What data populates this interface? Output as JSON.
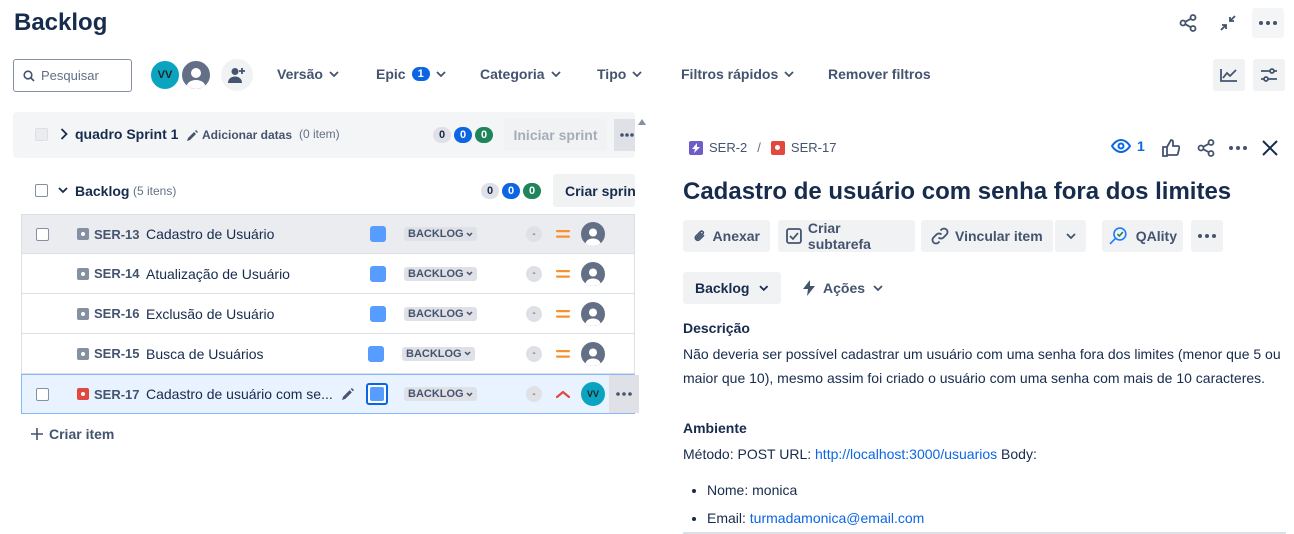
{
  "page": {
    "title": "Backlog"
  },
  "header": {
    "icons": [
      "share-icon",
      "collapse-icon",
      "more-icon"
    ]
  },
  "filters": {
    "search_placeholder": "Pesquisar",
    "avatar_initials": "VV",
    "items": [
      {
        "label": "Versão"
      },
      {
        "label": "Epic",
        "badge": "1"
      },
      {
        "label": "Categoria"
      },
      {
        "label": "Tipo"
      },
      {
        "label": "Filtros rápidos"
      }
    ],
    "clear_label": "Remover filtros"
  },
  "sprint": {
    "name": "quadro Sprint 1",
    "add_dates": "Adicionar datas",
    "count": "(0 item)",
    "counts": [
      "0",
      "0",
      "0"
    ],
    "start_label": "Iniciar sprint"
  },
  "backlog": {
    "name": "Backlog",
    "count": "(5 itens)",
    "counts": [
      "0",
      "0",
      "0"
    ],
    "create_sprint_label": "Criar sprint",
    "rows": [
      {
        "key": "SER-13",
        "summary": "Cadastro de Usuário",
        "status": "BACKLOG",
        "estimate": "-"
      },
      {
        "key": "SER-14",
        "summary": "Atualização de Usuário",
        "status": "BACKLOG",
        "estimate": "-"
      },
      {
        "key": "SER-16",
        "summary": "Exclusão de Usuário",
        "status": "BACKLOG",
        "estimate": "-"
      },
      {
        "key": "SER-15",
        "summary": "Busca de Usuários",
        "status": "BACKLOG",
        "estimate": "-"
      },
      {
        "key": "SER-17",
        "summary": "Cadastro de usuário com se...",
        "status": "BACKLOG",
        "estimate": "-",
        "assignee": "VV"
      }
    ],
    "create_item_label": "Criar item"
  },
  "detail": {
    "parent_key": "SER-2",
    "separator": "/",
    "key": "SER-17",
    "watchers": "1",
    "title": "Cadastro de usuário com senha fora dos limites",
    "actions": {
      "attach": "Anexar",
      "subtask": "Criar subtarefa",
      "link": "Vincular item",
      "qality": "QAlity"
    },
    "status_label": "Backlog",
    "actions_label": "Ações",
    "description_heading": "Descrição",
    "description": "Não deveria ser possível cadastrar um usuário com uma senha fora dos limites (menor que 5 ou maior que 10), mesmo assim foi criado o usuário com uma senha com mais de 10 caracteres.",
    "environment_heading": "Ambiente",
    "env_method": "Método: POST URL: ",
    "env_url": "http://localhost:3000/usuarios",
    "env_body": " Body:",
    "env_name": "Nome: monica",
    "env_email_prefix": "Email: ",
    "env_email": "turmadamonica@email.com"
  },
  "colors": {
    "accent": "#0c66e4",
    "epic": "#579dff",
    "bug": "#e2483d",
    "story": "#6e5dc6",
    "priority_medium": "#f79232",
    "priority_high": "#e2483d"
  }
}
